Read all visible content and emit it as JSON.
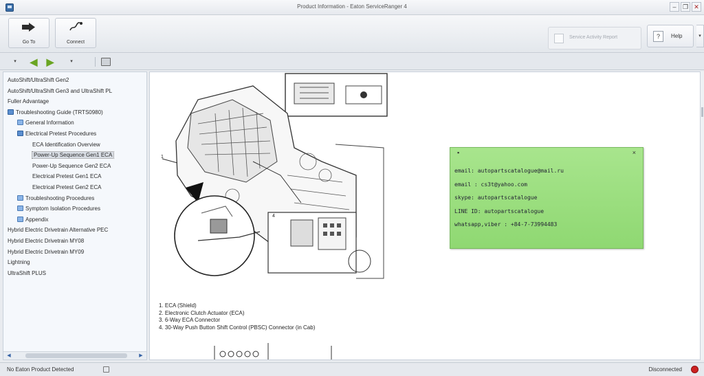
{
  "window": {
    "title": "Product Information - Eaton ServiceRanger 4",
    "minimize_glyph": "–",
    "restore_glyph": "❐",
    "close_glyph": "✕"
  },
  "ribbon": {
    "goto_label": "Go To",
    "connect_label": "Connect",
    "service_activity_label": "Service Activity Report",
    "help_label": "Help",
    "help_glyph": "?",
    "dropdown_glyph": "▾"
  },
  "navbar": {
    "dropdown_glyph": "▾",
    "back_glyph": "◀",
    "forward_glyph": "▶"
  },
  "tree": {
    "items": [
      {
        "label": "AutoShift/UltraShift Gen2",
        "level": 0,
        "icon": "",
        "selected": false
      },
      {
        "label": "AutoShift/UltraShift Gen3 and UltraShift PL",
        "level": 0,
        "icon": "",
        "selected": false
      },
      {
        "label": "Fuller Advantage",
        "level": 0,
        "icon": "",
        "selected": false
      },
      {
        "label": "Troubleshooting Guide (TRTS0980)",
        "level": 0,
        "icon": "book",
        "selected": false
      },
      {
        "label": "General Information",
        "level": 1,
        "icon": "folder",
        "selected": false
      },
      {
        "label": "Electrical Pretest Procedures",
        "level": 1,
        "icon": "book",
        "selected": false
      },
      {
        "label": "ECA Identification Overview",
        "level": 2,
        "icon": "",
        "selected": false
      },
      {
        "label": "Power-Up Sequence Gen1 ECA",
        "level": 2,
        "icon": "",
        "selected": true
      },
      {
        "label": "Power-Up Sequence Gen2 ECA",
        "level": 2,
        "icon": "",
        "selected": false
      },
      {
        "label": "Electrical Pretest Gen1 ECA",
        "level": 2,
        "icon": "",
        "selected": false
      },
      {
        "label": "Electrical Pretest Gen2 ECA",
        "level": 2,
        "icon": "",
        "selected": false
      },
      {
        "label": "Troubleshooting Procedures",
        "level": 1,
        "icon": "folder",
        "selected": false
      },
      {
        "label": "Symptom Isolation Procedures",
        "level": 1,
        "icon": "folder",
        "selected": false
      },
      {
        "label": "Appendix",
        "level": 1,
        "icon": "folder",
        "selected": false
      },
      {
        "label": "Hybrid Electric Drivetrain Alternative PEC",
        "level": 0,
        "icon": "",
        "selected": false
      },
      {
        "label": "Hybrid Electric Drivetrain MY08",
        "level": 0,
        "icon": "",
        "selected": false
      },
      {
        "label": "Hybrid Electric Drivetrain MY09",
        "level": 0,
        "icon": "",
        "selected": false
      },
      {
        "label": "Lightning",
        "level": 0,
        "icon": "",
        "selected": false
      },
      {
        "label": "UltraShift PLUS",
        "level": 0,
        "icon": "",
        "selected": false
      }
    ],
    "scroll_left_glyph": "◀",
    "scroll_right_glyph": "▶"
  },
  "document": {
    "callouts": [
      "1. ECA (Shield)",
      "2. Electronic Clutch Actuator (ECA)",
      "3. 6-Way ECA Connector",
      "4. 30-Way Push Button Shift Control (PBSC) Connector (in Cab)"
    ],
    "figure_number": "1",
    "inset_label": "4"
  },
  "note": {
    "pin_glyph": "▪",
    "close_glyph": "×",
    "lines": [
      "email: autopartscatalogue@mail.ru",
      "email : cs3t@yahoo.com",
      "skype: autopartscatalogue",
      "LINE ID: autopartscatalogue",
      "whatsapp,viber : +84-7-73994483"
    ],
    "color": "#9adf7e"
  },
  "status": {
    "left_text": "No Eaton Product Detected",
    "right_text": "Disconnected",
    "disconnected_color": "#cc2222"
  }
}
